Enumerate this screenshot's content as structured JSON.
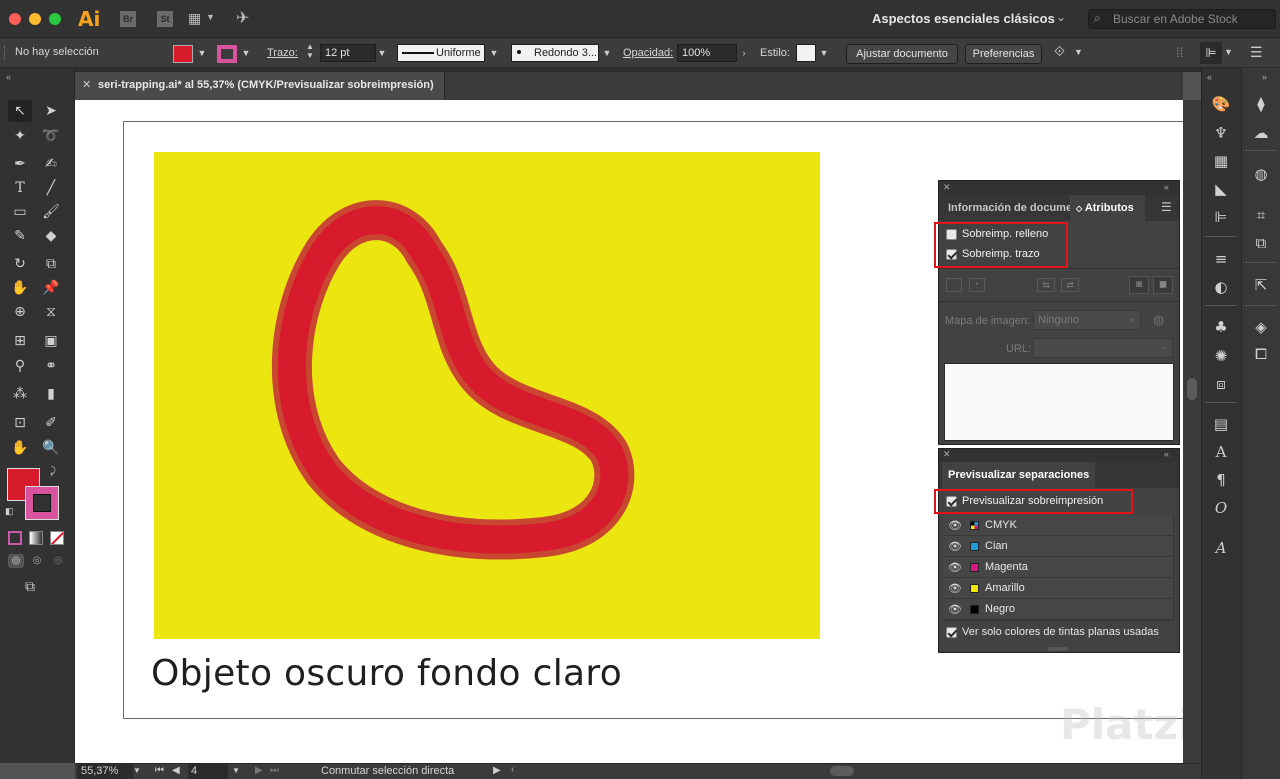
{
  "window": {
    "app_logo": "Ai",
    "bridge_label": "Br",
    "stock_label": "St",
    "workspace": "Aspectos esenciales clásicos",
    "stock_search_placeholder": "Buscar en Adobe Stock"
  },
  "control_bar": {
    "selection_status": "No hay selección",
    "fill_color": "#d71a2c",
    "stroke_color": "#d9549e",
    "stroke_label": "Trazo:",
    "stroke_weight": "12 pt",
    "stroke_profile": "Uniforme",
    "brush": "Redondo 3...",
    "opacity_label": "Opacidad:",
    "opacity_value": "100%",
    "style_label": "Estilo:",
    "document_setup_button": "Ajustar documento",
    "preferences_button": "Preferencias"
  },
  "document_tab": {
    "title": "seri-trapping.ai* al 55,37% (CMYK/Previsualizar sobreimpresión)"
  },
  "canvas": {
    "background_color": "#ebe510",
    "shape_fill": "#d71a2c",
    "shape_stroke": "#c94730",
    "caption": "Objeto oscuro fondo claro"
  },
  "attributes_panel": {
    "tab_document_info": "Información de docume",
    "tab_attributes": "Atributos",
    "overprint_fill_label": "Sobreimp. relleno",
    "overprint_fill_checked": false,
    "overprint_stroke_label": "Sobreimp. trazo",
    "overprint_stroke_checked": true,
    "image_map_label": "Mapa de imagen:",
    "image_map_value": "Ninguno",
    "url_label": "URL:"
  },
  "separations_panel": {
    "title": "Previsualizar separaciones",
    "overprint_preview_label": "Previsualizar sobreimpresión",
    "overprint_preview_checked": true,
    "separations": [
      {
        "name": "CMYK",
        "color": "#888888"
      },
      {
        "name": "Cian",
        "color": "#1f9bd7"
      },
      {
        "name": "Magenta",
        "color": "#d6177f"
      },
      {
        "name": "Amarillo",
        "color": "#f3e300"
      },
      {
        "name": "Negro",
        "color": "#000000"
      }
    ],
    "spot_only_label": "Ver solo colores de tintas planas usadas",
    "spot_only_checked": true
  },
  "status_bar": {
    "zoom": "55,37%",
    "artboard_number": "4",
    "current_tool": "Conmutar selección directa"
  },
  "watermark": "Platzi"
}
